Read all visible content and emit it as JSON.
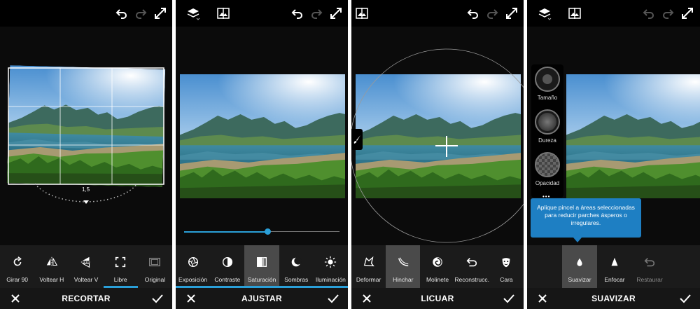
{
  "colors": {
    "accent": "#2a9fd8",
    "tooltip": "#1e7fc3",
    "panel_bg": "#0b0b0b",
    "selected_tool": "#4a4a4a"
  },
  "panels": [
    {
      "title": "RECORTAR",
      "angle_value": "1,5",
      "tools": [
        {
          "label": "Girar 90",
          "icon": "rotate-icon"
        },
        {
          "label": "Voltear H",
          "icon": "flip-horizontal-icon"
        },
        {
          "label": "Voltear V",
          "icon": "flip-vertical-icon"
        },
        {
          "label": "Libre",
          "icon": "free-crop-icon"
        },
        {
          "label": "Original",
          "icon": "original-ratio-icon"
        }
      ]
    },
    {
      "title": "AJUSTAR",
      "slider_fraction": 0.54,
      "tools": [
        {
          "label": "Exposición",
          "icon": "exposure-icon"
        },
        {
          "label": "Contraste",
          "icon": "contrast-icon"
        },
        {
          "label": "Saturación",
          "icon": "saturation-icon"
        },
        {
          "label": "Sombras",
          "icon": "shadows-icon"
        },
        {
          "label": "Iluminación",
          "icon": "highlights-icon"
        }
      ]
    },
    {
      "title": "LICUAR",
      "tools": [
        {
          "label": "Deformar",
          "icon": "warp-icon"
        },
        {
          "label": "Hinchar",
          "icon": "bloat-icon"
        },
        {
          "label": "Molinete",
          "icon": "swirl-icon"
        },
        {
          "label": "Reconstrucc.",
          "icon": "reconstruct-icon"
        },
        {
          "label": "Cara",
          "icon": "face-icon"
        }
      ]
    },
    {
      "title": "SUAVIZAR",
      "brush_controls": [
        {
          "label": "Tamaño"
        },
        {
          "label": "Dureza"
        },
        {
          "label": "Opacidad"
        }
      ],
      "tooltip": "Aplique pincel a áreas seleccionadas para reducir parches ásperos o irregulares.",
      "tools": [
        {
          "label": "Suavizar",
          "icon": "drop-icon"
        },
        {
          "label": "Enfocar",
          "icon": "sharpen-icon"
        },
        {
          "label": "Restaurar",
          "icon": "restore-icon"
        }
      ]
    }
  ]
}
